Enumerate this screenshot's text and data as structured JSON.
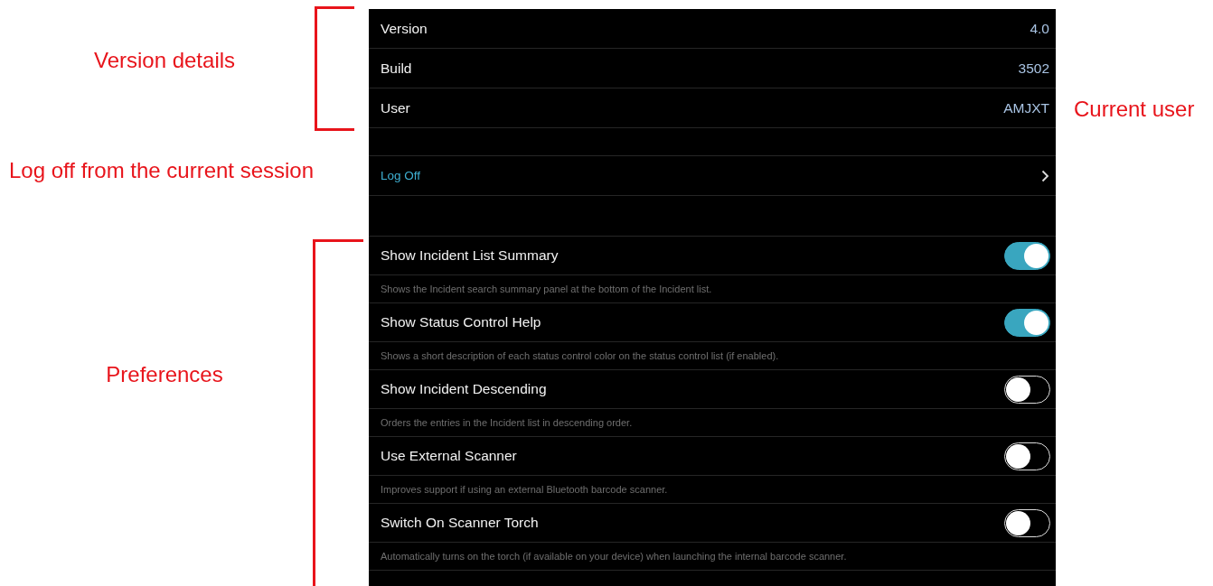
{
  "annotations": {
    "version_details": "Version details",
    "current_user": "Current user",
    "log_off": "Log off from the current session",
    "preferences": "Preferences"
  },
  "about": [
    {
      "label": "Version",
      "value": "4.0"
    },
    {
      "label": "Build",
      "value": "3502"
    },
    {
      "label": "User",
      "value": "AMJXT"
    }
  ],
  "log_off": {
    "label": "Log Off"
  },
  "preferences": [
    {
      "label": "Show Incident List Summary",
      "on": true,
      "description": "Shows the Incident search summary panel at the bottom of the Incident list."
    },
    {
      "label": "Show Status Control Help",
      "on": true,
      "description": "Shows a short description of each status control color on the status control list (if enabled)."
    },
    {
      "label": "Show Incident Descending",
      "on": false,
      "description": "Orders the entries in the Incident list in descending order."
    },
    {
      "label": "Use External Scanner",
      "on": false,
      "description": "Improves support if using an external Bluetooth barcode scanner."
    },
    {
      "label": "Switch On Scanner Torch",
      "on": false,
      "description": "Automatically turns on the torch (if available on your device) when launching the internal barcode scanner."
    }
  ]
}
